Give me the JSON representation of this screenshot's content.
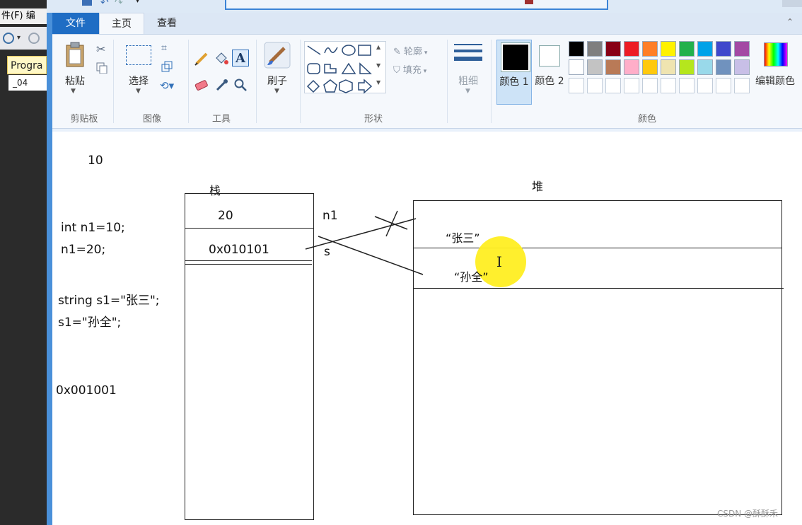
{
  "background_app": {
    "menu_text": "件(F)   编",
    "tab_label": "Progra",
    "file_label": "_04"
  },
  "paint": {
    "tabs": {
      "file": "文件",
      "home": "主页",
      "view": "查看"
    },
    "groups": {
      "clipboard": {
        "label": "剪贴板",
        "paste": "粘贴"
      },
      "image": {
        "label": "图像",
        "select": "选择"
      },
      "tools": {
        "label": "工具"
      },
      "brush": {
        "label": "刷子"
      },
      "shapes": {
        "label": "形状",
        "outline": "轮廓",
        "fill": "填充"
      },
      "size": {
        "label": "粗细"
      },
      "colors": {
        "label": "颜色",
        "color1": "颜色 1",
        "color2": "颜色 2",
        "edit": "编辑颜色",
        "row1": [
          "#000000",
          "#7f7f7f",
          "#880015",
          "#ed1c24",
          "#ff7f27",
          "#fff200",
          "#22b14c",
          "#00a2e8",
          "#3f48cc",
          "#a349a4"
        ],
        "row2": [
          "#ffffff",
          "#c3c3c3",
          "#b97a57",
          "#ffaec9",
          "#ffc90e",
          "#efe4b0",
          "#b5e61d",
          "#99d9ea",
          "#7092be",
          "#c8bfe7"
        ]
      }
    }
  },
  "drawing": {
    "left_notes": {
      "value_top": "10",
      "code1": "int n1=10;",
      "code2": "n1=20;",
      "code3": "string s1=\"张三\";",
      "code4": "s1=\"孙全\";",
      "address": "0x001001"
    },
    "stack": {
      "title": "栈",
      "cell1": "20",
      "cell2": "0x010101",
      "var1": "n1",
      "var2": "s"
    },
    "heap": {
      "title": "堆",
      "cell1": "“张三”",
      "cell2": "“孙全”"
    }
  },
  "watermark": "CSDN @酥酥禾",
  "icons": [
    "paste-icon",
    "cut-icon",
    "copy-icon",
    "select-icon",
    "crop-icon",
    "resize-icon",
    "rotate-icon",
    "pencil-icon",
    "fill-bucket-icon",
    "text-icon",
    "eraser-icon",
    "color-picker-icon",
    "magnifier-icon",
    "brush-icon",
    "text-cursor-icon"
  ]
}
